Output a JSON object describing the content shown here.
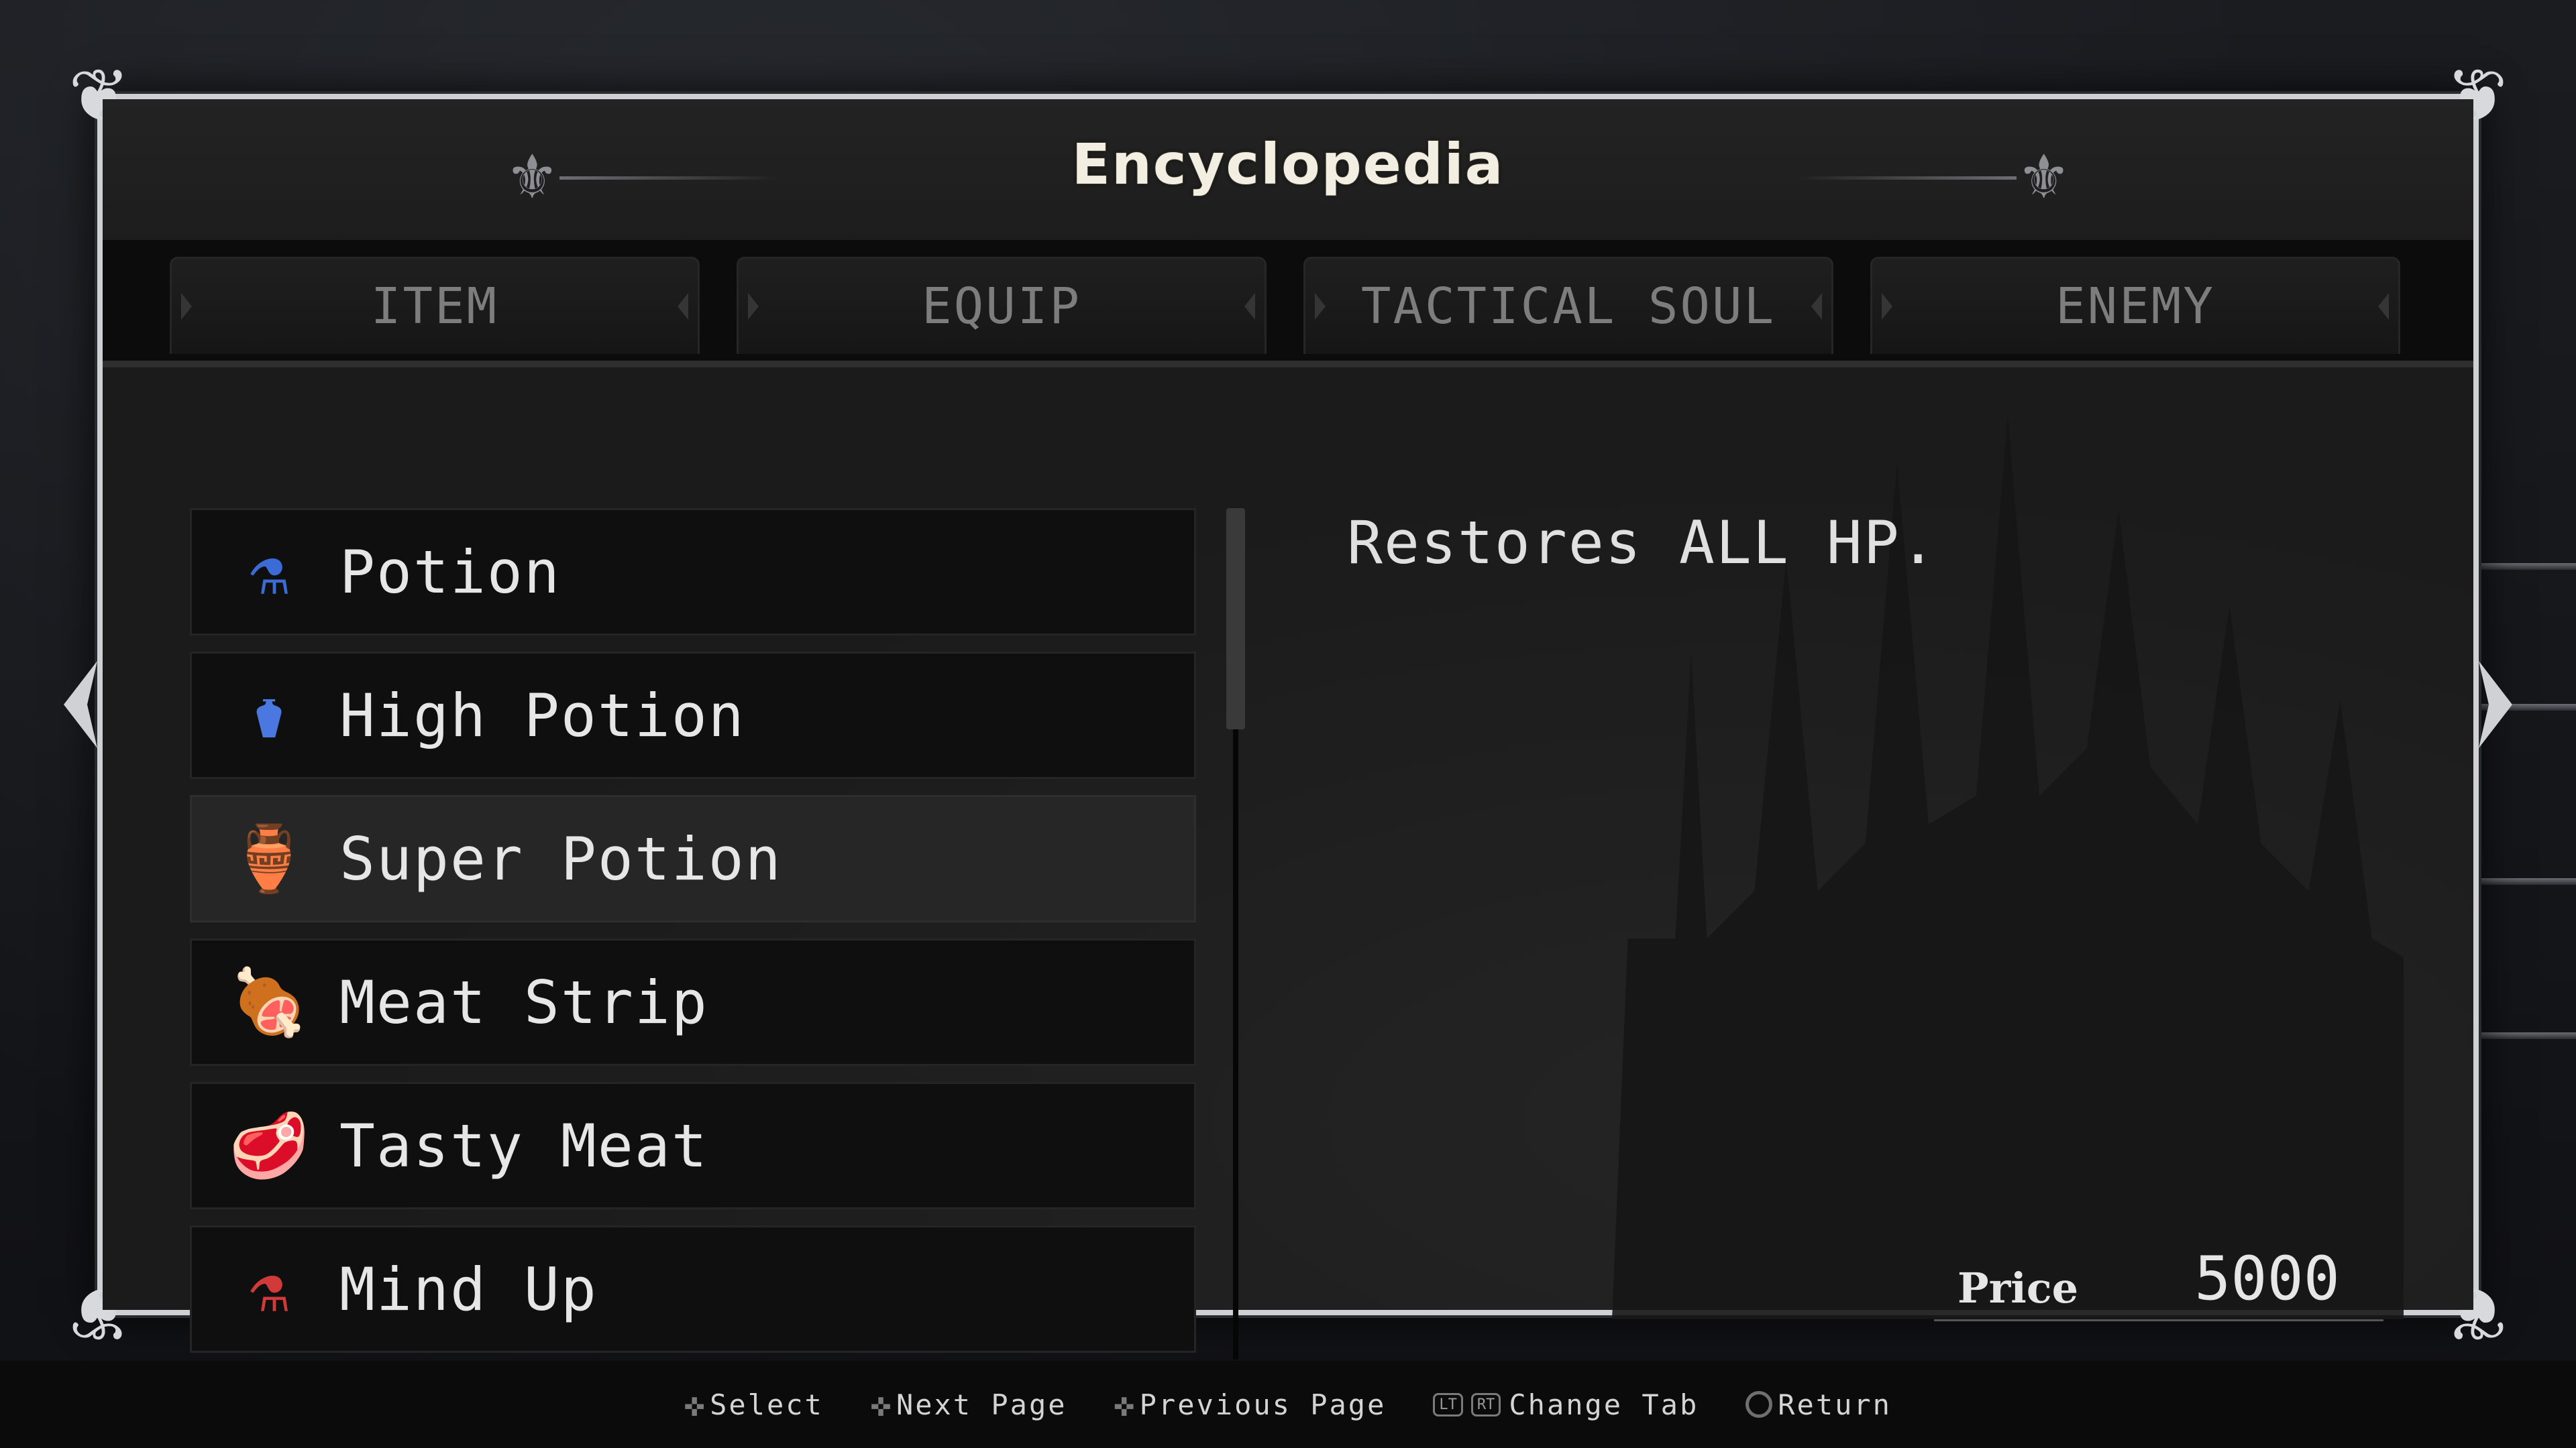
{
  "window": {
    "title": "Encyclopedia"
  },
  "tabs": [
    {
      "label": "ITEM",
      "active": true
    },
    {
      "label": "EQUIP",
      "active": false
    },
    {
      "label": "TACTICAL SOUL",
      "active": false
    },
    {
      "label": "ENEMY",
      "active": false
    }
  ],
  "items": [
    {
      "label": "Potion",
      "icon": "blue-potion-icon",
      "glyph": "⚗",
      "color": "#3a6bd6",
      "selected": false
    },
    {
      "label": "High Potion",
      "icon": "high-potion-icon",
      "glyph": "⚱",
      "color": "#4a78e0",
      "selected": false
    },
    {
      "label": "Super Potion",
      "icon": "super-potion-icon",
      "glyph": "🏺",
      "color": "#3d66e8",
      "selected": true
    },
    {
      "label": "Meat Strip",
      "icon": "meat-strip-icon",
      "glyph": "🍖",
      "color": "#d94a26",
      "selected": false
    },
    {
      "label": "Tasty Meat",
      "icon": "tasty-meat-icon",
      "glyph": "🥩",
      "color": "#c9402a",
      "selected": false
    },
    {
      "label": "Mind Up",
      "icon": "red-potion-icon",
      "glyph": "⚗",
      "color": "#d23a3a",
      "selected": false
    }
  ],
  "detail": {
    "description": "Restores ALL HP.",
    "price_label": "Price",
    "price_value": "5000"
  },
  "scroll": {
    "position_fraction": 0.0
  },
  "footer": {
    "hints": [
      {
        "icon": "dpad-icon",
        "text": "Select"
      },
      {
        "icon": "dpad-icon",
        "text": "Next Page"
      },
      {
        "icon": "dpad-icon",
        "text": "Previous Page"
      },
      {
        "icon": "lt-rt-buttons-icon",
        "buttons": [
          "LT",
          "RT"
        ],
        "text": "Change Tab"
      },
      {
        "icon": "circle-button-icon",
        "text": "Return"
      }
    ]
  },
  "colors": {
    "panel_border": "#cfd0d4",
    "active_tab_text": "#eeeeee",
    "inactive_tab_text": "#7d7d7d",
    "title_text": "#f2eee2"
  }
}
